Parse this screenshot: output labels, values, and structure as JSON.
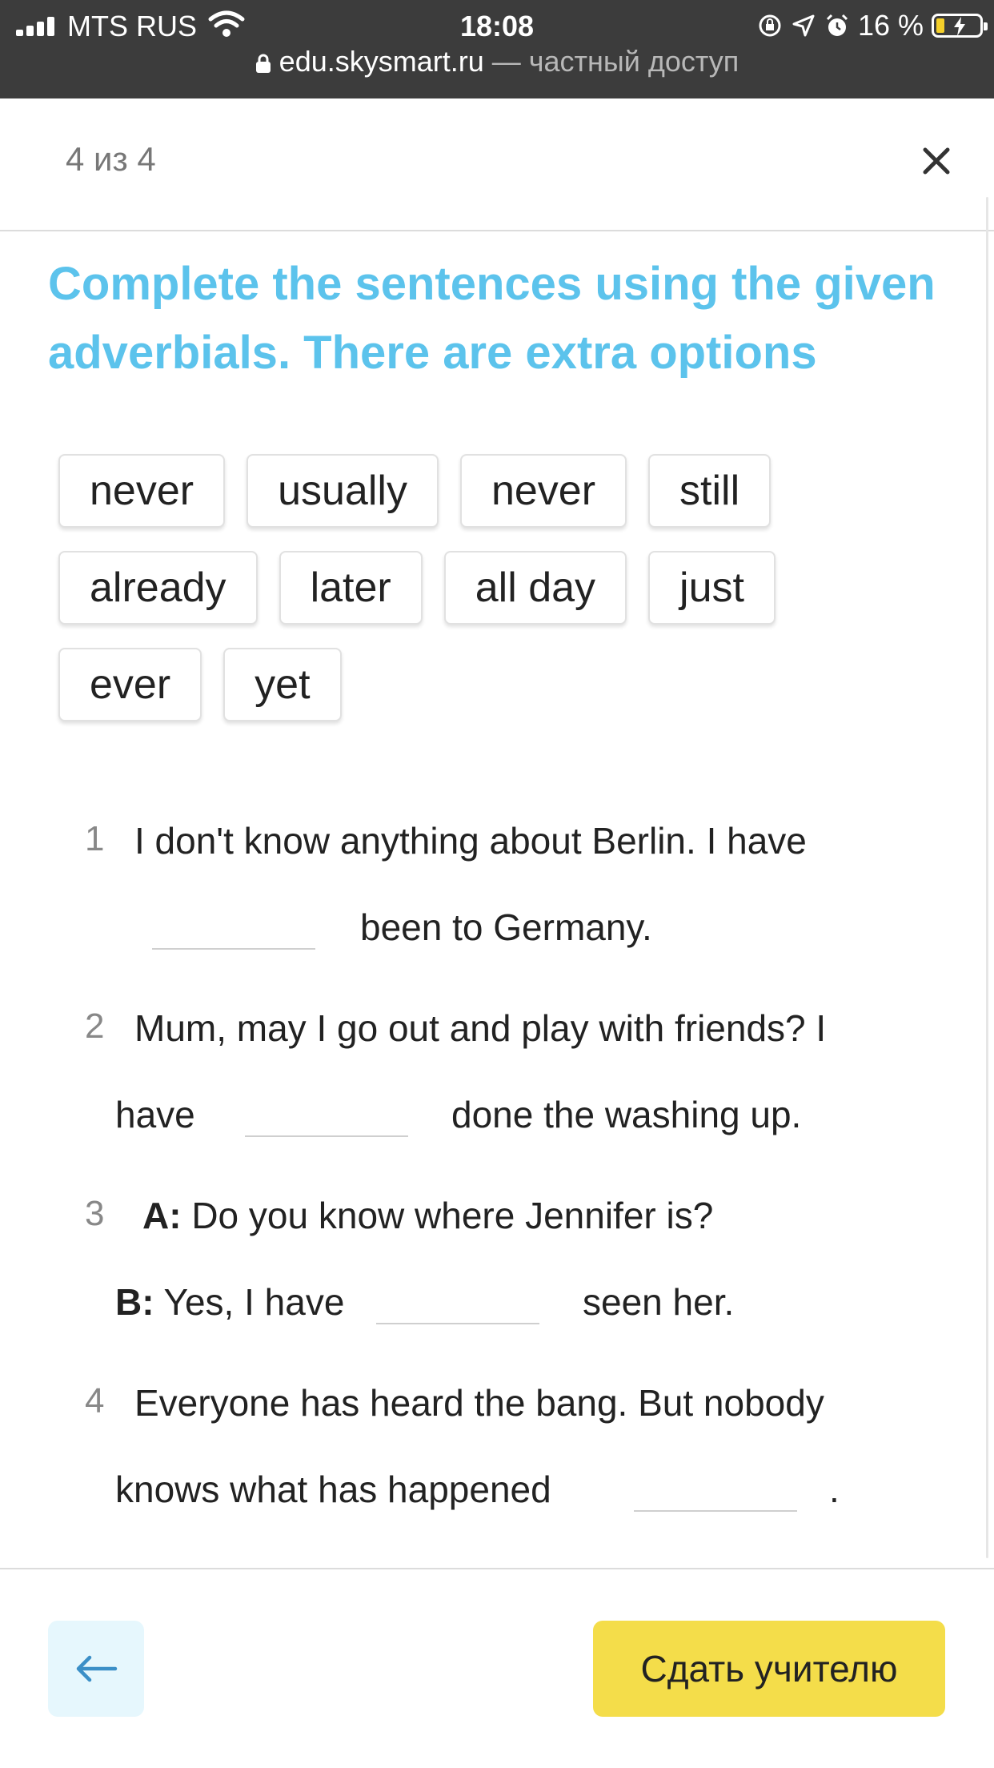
{
  "status_bar": {
    "carrier": "MTS RUS",
    "time": "18:08",
    "battery": "16 %",
    "battery_level": 0.16,
    "url_domain": "edu.skysmart.ru",
    "url_suffix": " — частный доступ"
  },
  "header": {
    "progress": "4 из 4"
  },
  "task": {
    "title": "Complete the sentences using the given adverbials. There are extra options"
  },
  "word_bank": {
    "rows": [
      [
        "never",
        "usually",
        "never",
        "still"
      ],
      [
        "already",
        "later",
        "all day",
        "just"
      ],
      [
        "ever",
        "yet"
      ]
    ]
  },
  "questions": [
    {
      "number": "1",
      "line1": "I don't know anything about Berlin. I have",
      "line2_after": "been to Germany."
    },
    {
      "number": "2",
      "line1": "Mum, may I go out and play with friends? I",
      "line2_before": "have",
      "line2_after": "done the washing up."
    },
    {
      "number": "3",
      "line1_speaker": "A:",
      "line1": "Do you know where Jennifer is?",
      "line2_speaker": "B:",
      "line2_before": "Yes, I have",
      "line2_after": "seen her."
    },
    {
      "number": "4",
      "line1": "Everyone has heard the bang. But nobody",
      "line2_before": "knows what has happened",
      "line2_after": "."
    }
  ],
  "footer": {
    "submit_label": "Сдать учителю"
  },
  "colors": {
    "title": "#5cc3ec",
    "submit_bg": "#f4dd4a",
    "back_bg": "#e6f7fd",
    "status_bar_bg": "#3c3c3c"
  }
}
